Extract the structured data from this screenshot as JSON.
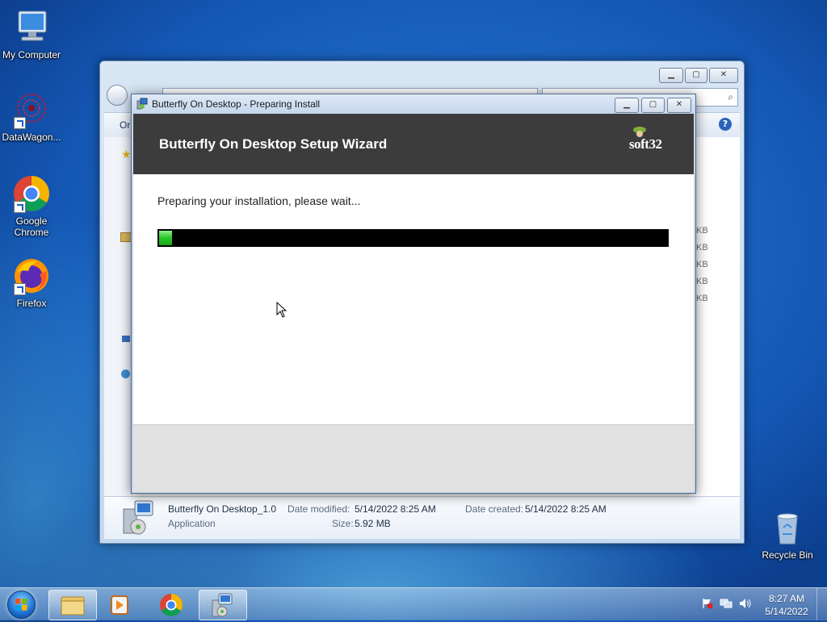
{
  "desktop": {
    "icons": [
      {
        "label": "My Computer"
      },
      {
        "label": "DataWagon..."
      },
      {
        "label": "Google Chrome"
      },
      {
        "label": "Firefox"
      },
      {
        "label": "Recycle Bin"
      }
    ]
  },
  "explorer": {
    "toolbar_organize": "Or",
    "size_column": [
      "KB",
      "KB",
      "KB",
      "KB",
      "KB"
    ],
    "details": {
      "file_name": "Butterfly On Desktop_1.0",
      "file_type": "Application",
      "date_modified_label": "Date modified:",
      "date_modified_value": "5/14/2022 8:25 AM",
      "size_label": "Size:",
      "size_value": "5.92 MB",
      "date_created_label": "Date created:",
      "date_created_value": "5/14/2022 8:25 AM"
    }
  },
  "wizard": {
    "window_title": "Butterfly On Desktop - Preparing Install",
    "heading": "Butterfly On Desktop Setup Wizard",
    "logo_text": "soft32",
    "status_text": "Preparing your installation, please wait...",
    "progress_fraction": 0.025,
    "colors": {
      "progress_fill": "#28c428",
      "header_bg": "#3c3c3c"
    }
  },
  "taskbar": {
    "pinned": [
      "windows-explorer-icon",
      "media-player-icon",
      "chrome-icon",
      "installer-icon"
    ],
    "clock_time": "8:27 AM",
    "clock_date": "5/14/2022"
  }
}
